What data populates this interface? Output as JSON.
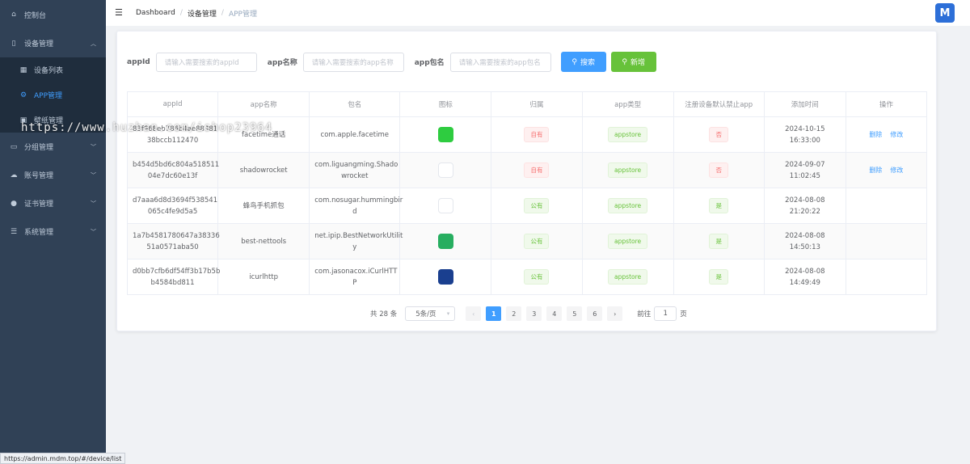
{
  "sidebar": {
    "items": [
      {
        "label": "控制台",
        "icon": "home-icon"
      },
      {
        "label": "设备管理",
        "icon": "device-icon",
        "expanded": true,
        "children": [
          {
            "label": "设备列表",
            "icon": "grid-icon"
          },
          {
            "label": "APP管理",
            "icon": "app-icon",
            "active": true
          },
          {
            "label": "壁纸管理",
            "icon": "image-icon"
          }
        ]
      },
      {
        "label": "分组管理",
        "icon": "folder-icon"
      },
      {
        "label": "账号管理",
        "icon": "cloud-icon"
      },
      {
        "label": "证书管理",
        "icon": "user-icon"
      },
      {
        "label": "系统管理",
        "icon": "settings-icon"
      }
    ]
  },
  "breadcrumb": [
    "Dashboard",
    "设备管理",
    "APP管理"
  ],
  "logo_text": "M",
  "search": {
    "appid_label": "appId",
    "appid_placeholder": "请输入需要搜索的appId",
    "appname_label": "app名称",
    "appname_placeholder": "请输入需要搜索的app名称",
    "pkg_label": "app包名",
    "pkg_placeholder": "请输入需要搜索的app包名",
    "search_button": "搜索",
    "add_button": "新增"
  },
  "table": {
    "headers": [
      "appId",
      "app名称",
      "包名",
      "图标",
      "归属",
      "app类型",
      "注册设备默认禁止app",
      "添加时间",
      "操作"
    ],
    "rows": [
      {
        "appid": "83f668eb786b4ae8838138bccb112470",
        "appid_l1": "83f668eb786b4ae88381",
        "appid_l2": "38bccb112470",
        "name": "facetime通话",
        "pkg_l1": "com.apple.facetime",
        "pkg_l2": "",
        "icon": "facetime-icon",
        "icon_color": "#2ecc40",
        "owner": "自有",
        "type": "appstore",
        "forbid": "否",
        "time": "2024-10-15 16:33:00",
        "ops": [
          "删除",
          "修改"
        ]
      },
      {
        "appid": "b454d5bd6c804a51851104e7dc60e13f",
        "appid_l1": "b454d5bd6c804a518511",
        "appid_l2": "04e7dc60e13f",
        "name": "shadowrocket",
        "pkg_l1": "com.liguangming.Shado",
        "pkg_l2": "wrocket",
        "icon": "rocket-icon",
        "icon_color": "#ffffff",
        "owner": "自有",
        "type": "appstore",
        "forbid": "否",
        "time": "2024-09-07 11:02:45",
        "ops": [
          "删除",
          "修改"
        ]
      },
      {
        "appid": "d7aaa6d8d3694f538541065c4fe9d5a5",
        "appid_l1": "d7aaa6d8d3694f538541",
        "appid_l2": "065c4fe9d5a5",
        "name": "蜂鸟手机抓包",
        "pkg_l1": "com.nosugar.hummingbir",
        "pkg_l2": "d",
        "icon": "hummingbird-icon",
        "icon_color": "#ffffff",
        "owner": "公有",
        "type": "appstore",
        "forbid": "是",
        "time": "2024-08-08 21:20:22",
        "ops": []
      },
      {
        "appid": "1a7b4581780647a3833651a0571aba50",
        "appid_l1": "1a7b4581780647a38336",
        "appid_l2": "51a0571aba50",
        "name": "best-nettools",
        "pkg_l1": "net.ipip.BestNetworkUtilit",
        "pkg_l2": "y",
        "icon": "tools-icon",
        "icon_color": "#27ae60",
        "owner": "公有",
        "type": "appstore",
        "forbid": "是",
        "time": "2024-08-08 14:50:13",
        "ops": []
      },
      {
        "appid": "d0bb7cfb6df54ff3b17b5bb4584bd811",
        "appid_l1": "d0bb7cfb6df54ff3b17b5b",
        "appid_l2": "b4584bd811",
        "name": "icurlhttp",
        "pkg_l1": "com.jasonacox.iCurlHTT",
        "pkg_l2": "P",
        "icon": "curl-icon",
        "icon_color": "#1a3f8f",
        "owner": "公有",
        "type": "appstore",
        "forbid": "是",
        "time": "2024-08-08 14:49:49",
        "ops": []
      }
    ]
  },
  "pagination": {
    "total": "共 28 条",
    "page_size": "5条/页",
    "pages": [
      "1",
      "2",
      "3",
      "4",
      "5",
      "6"
    ],
    "current": "1",
    "goto_label": "前往",
    "goto_value": "1",
    "goto_suffix": "页"
  },
  "watermark": "https://www.huzhan.com/ishop23964",
  "status_url": "https://admin.mdm.top/#/device/list"
}
